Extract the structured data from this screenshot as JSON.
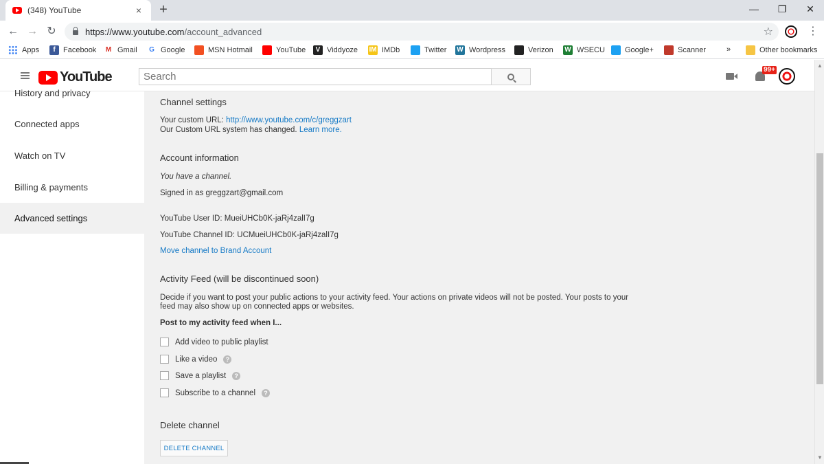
{
  "browser": {
    "tab_title": "(348) YouTube",
    "tab_close": "×",
    "new_tab": "+",
    "window_controls": {
      "minimize": "—",
      "restore": "❐",
      "close": "✕"
    },
    "url_host": "https://www.youtube.com",
    "url_path": "/account_advanced",
    "bookmarks": [
      {
        "label": "Apps",
        "icon": "apps-grid-icon",
        "color": "#4285f4"
      },
      {
        "label": "Facebook",
        "icon": "facebook-icon",
        "color": "#3b5998"
      },
      {
        "label": "Gmail",
        "icon": "gmail-icon",
        "color": "#d93025"
      },
      {
        "label": "Google",
        "icon": "google-icon",
        "color": "#4285f4"
      },
      {
        "label": "MSN Hotmail",
        "icon": "msn-icon",
        "color": "#f25022"
      },
      {
        "label": "YouTube",
        "icon": "youtube-icon",
        "color": "#ff0000"
      },
      {
        "label": "Viddyoze",
        "icon": "viddyoze-icon",
        "color": "#222222"
      },
      {
        "label": "IMDb",
        "icon": "imdb-icon",
        "color": "#f5c518"
      },
      {
        "label": "Twitter",
        "icon": "twitter-icon",
        "color": "#1da1f2"
      },
      {
        "label": "Wordpress",
        "icon": "wordpress-icon",
        "color": "#21759b"
      },
      {
        "label": "Verizon",
        "icon": "verizon-icon",
        "color": "#222222"
      },
      {
        "label": "WSECU",
        "icon": "wsecu-icon",
        "color": "#1e7e34"
      },
      {
        "label": "Google+",
        "icon": "twitter-bird-icon",
        "color": "#1da1f2"
      },
      {
        "label": "Scanner",
        "icon": "scanner-icon",
        "color": "#c0392b"
      }
    ],
    "bookmarks_overflow": "»",
    "other_bookmarks": "Other bookmarks"
  },
  "youtube": {
    "logo_text": "YouTube",
    "search_placeholder": "Search",
    "notification_count": "99+"
  },
  "sidebar": {
    "items": [
      {
        "label": "History and privacy",
        "active": false
      },
      {
        "label": "Connected apps",
        "active": false
      },
      {
        "label": "Watch on TV",
        "active": false
      },
      {
        "label": "Billing & payments",
        "active": false
      },
      {
        "label": "Advanced settings",
        "active": true
      }
    ]
  },
  "main": {
    "channel_settings": {
      "title": "Channel settings",
      "custom_url_label": "Your custom URL: ",
      "custom_url": "http://www.youtube.com/c/greggzart",
      "custom_url_note": "Our Custom URL system has changed. ",
      "learn_more": "Learn more."
    },
    "account_info": {
      "title": "Account information",
      "has_channel": "You have a channel.",
      "signed_in": "Signed in as greggzart@gmail.com",
      "user_id": "YouTube User ID: MueiUHCb0K-jaRj4zalI7g",
      "channel_id": "YouTube Channel ID: UCMueiUHCb0K-jaRj4zalI7g",
      "move_channel": "Move channel to Brand Account"
    },
    "activity_feed": {
      "title": "Activity Feed (will be discontinued soon)",
      "desc_line1": "Decide if you want to post your public actions to your activity feed. Your actions on private videos will not be posted. Your posts to your",
      "desc_line2": "feed may also show up on connected apps or websites.",
      "post_when": "Post to my activity feed when I...",
      "options": [
        {
          "label": "Add video to public playlist",
          "checked": false,
          "help": false
        },
        {
          "label": "Like a video",
          "checked": false,
          "help": true
        },
        {
          "label": "Save a playlist",
          "checked": false,
          "help": true
        },
        {
          "label": "Subscribe to a channel",
          "checked": false,
          "help": true
        }
      ],
      "help_glyph": "?"
    },
    "delete_channel": {
      "title": "Delete channel",
      "button": "DELETE CHANNEL"
    }
  }
}
